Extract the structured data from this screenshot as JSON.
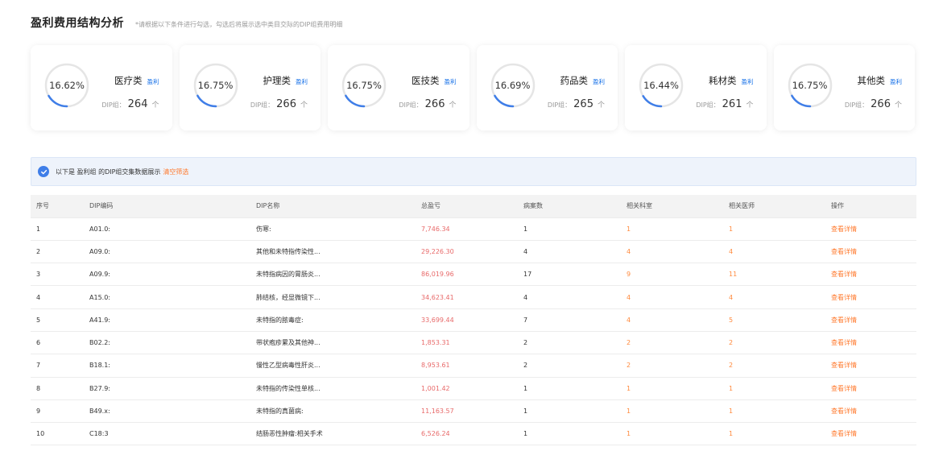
{
  "header": {
    "title": "盈利费用结构分析",
    "hint": "*请根据以下条件进行勾选，勾选后将展示选中类目交际的DIP组费用明细"
  },
  "cards": [
    {
      "percent": "16.62%",
      "fraction": 0.1662,
      "category": "医疗类",
      "tag": "盈利",
      "dip_label": "DIP组：",
      "dip_count": "264",
      "dip_unit": "个"
    },
    {
      "percent": "16.75%",
      "fraction": 0.1675,
      "category": "护理类",
      "tag": "盈利",
      "dip_label": "DIP组：",
      "dip_count": "266",
      "dip_unit": "个"
    },
    {
      "percent": "16.75%",
      "fraction": 0.1675,
      "category": "医技类",
      "tag": "盈利",
      "dip_label": "DIP组：",
      "dip_count": "266",
      "dip_unit": "个"
    },
    {
      "percent": "16.69%",
      "fraction": 0.1669,
      "category": "药品类",
      "tag": "盈利",
      "dip_label": "DIP组：",
      "dip_count": "265",
      "dip_unit": "个"
    },
    {
      "percent": "16.44%",
      "fraction": 0.1644,
      "category": "耗材类",
      "tag": "盈利",
      "dip_label": "DIP组：",
      "dip_count": "261",
      "dip_unit": "个"
    },
    {
      "percent": "16.75%",
      "fraction": 0.1675,
      "category": "其他类",
      "tag": "盈利",
      "dip_label": "DIP组：",
      "dip_count": "266",
      "dip_unit": "个"
    }
  ],
  "colors": {
    "ring_track": "#e5e5e5",
    "ring_fill": "#3f7ee8",
    "accent_orange": "#ff7a2e",
    "profit_red": "#e86a6a"
  },
  "filter": {
    "text": "以下是 盈利组 的DIP组交集数据展示",
    "clear": "清空筛选",
    "icon": "check-circle-icon"
  },
  "table": {
    "columns": [
      "序号",
      "DIP编码",
      "DIP名称",
      "总盈亏",
      "病案数",
      "相关科室",
      "相关医师",
      "操作"
    ],
    "rows": [
      [
        "1",
        "A01.0:",
        "伤寒:",
        "7,746.34",
        "1",
        "1",
        "1",
        "查看详情"
      ],
      [
        "2",
        "A09.0:",
        "其他和未特指传染性...",
        "29,226.30",
        "4",
        "4",
        "4",
        "查看详情"
      ],
      [
        "3",
        "A09.9:",
        "未特指病因的胃肠炎...",
        "86,019.96",
        "17",
        "9",
        "11",
        "查看详情"
      ],
      [
        "4",
        "A15.0:",
        "肺结核，经显微镜下...",
        "34,623.41",
        "4",
        "4",
        "4",
        "查看详情"
      ],
      [
        "5",
        "A41.9:",
        "未特指的脓毒症:",
        "33,699.44",
        "7",
        "4",
        "5",
        "查看详情"
      ],
      [
        "6",
        "B02.2:",
        "带状疱疹累及其他神...",
        "1,853.31",
        "2",
        "2",
        "2",
        "查看详情"
      ],
      [
        "7",
        "B18.1:",
        "慢性乙型病毒性肝炎...",
        "8,953.61",
        "2",
        "2",
        "2",
        "查看详情"
      ],
      [
        "8",
        "B27.9:",
        "未特指的传染性单核...",
        "1,001.42",
        "1",
        "1",
        "1",
        "查看详情"
      ],
      [
        "9",
        "B49.x:",
        "未特指的真菌病:",
        "11,163.57",
        "1",
        "1",
        "1",
        "查看详情"
      ],
      [
        "10",
        "C18:3",
        "结肠恶性肿瘤:相关手术",
        "6,526.24",
        "1",
        "1",
        "1",
        "查看详情"
      ]
    ]
  }
}
